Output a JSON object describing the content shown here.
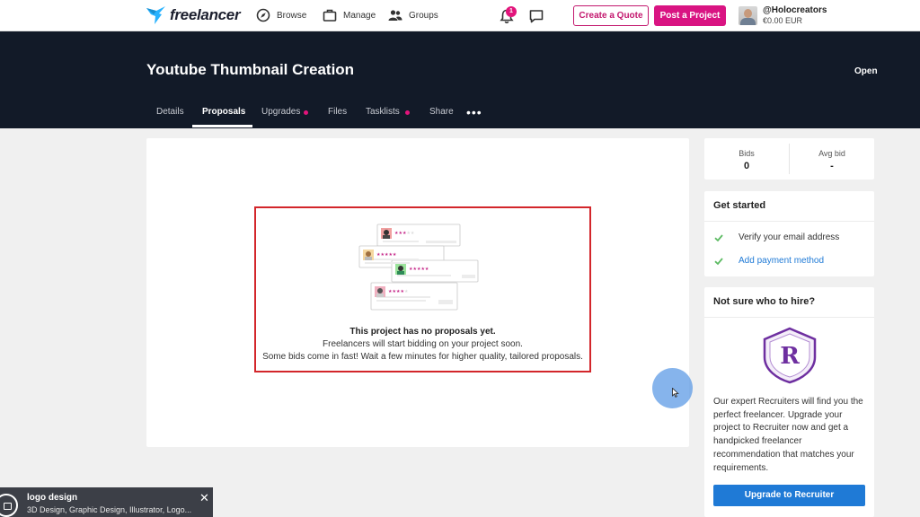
{
  "nav": {
    "logo_text": "freelancer",
    "browse": "Browse",
    "manage": "Manage",
    "groups": "Groups",
    "notification_count": "1",
    "create_quote": "Create a Quote",
    "post_project": "Post a Project",
    "username": "@Holocreators",
    "balance": "€0.00 EUR"
  },
  "project": {
    "title": "Youtube Thumbnail Creation",
    "status": "Open",
    "tabs": [
      {
        "label": "Details",
        "active": false
      },
      {
        "label": "Proposals",
        "active": true
      },
      {
        "label": "Upgrades",
        "active": false,
        "dot": true
      },
      {
        "label": "Files",
        "active": false
      },
      {
        "label": "Tasklists",
        "active": false,
        "dot": true
      },
      {
        "label": "Share",
        "active": false
      }
    ],
    "more": "•••"
  },
  "proposals": {
    "empty_title": "This project has no proposals yet.",
    "empty_line1": "Freelancers will start bidding on your project soon.",
    "empty_line2": "Some bids come in fast! Wait a few minutes for higher quality, tailored proposals."
  },
  "sidebar": {
    "bids_label": "Bids",
    "bids_value": "0",
    "avg_bid_label": "Avg bid",
    "avg_bid_value": "-",
    "get_started_title": "Get started",
    "tasks": [
      {
        "label": "Verify your email address",
        "done": true,
        "link": false
      },
      {
        "label": "Add payment method",
        "done": true,
        "link": true
      }
    ],
    "hire_title": "Not sure who to hire?",
    "recruiter_letter": "R",
    "hire_description": "Our expert Recruiters will find you the perfect freelancer. Upgrade your project to Recruiter now and get a handpicked freelancer recommendation that matches your requirements.",
    "upgrade_button": "Upgrade to Recruiter"
  },
  "toast": {
    "title": "logo design",
    "subtitle": "3D Design, Graphic Design, Illustrator, Logo..."
  },
  "colors": {
    "brand_pink": "#d91482",
    "header_dark": "#121a28",
    "link_blue": "#1f7ad6",
    "highlight_red": "#d3262b"
  }
}
